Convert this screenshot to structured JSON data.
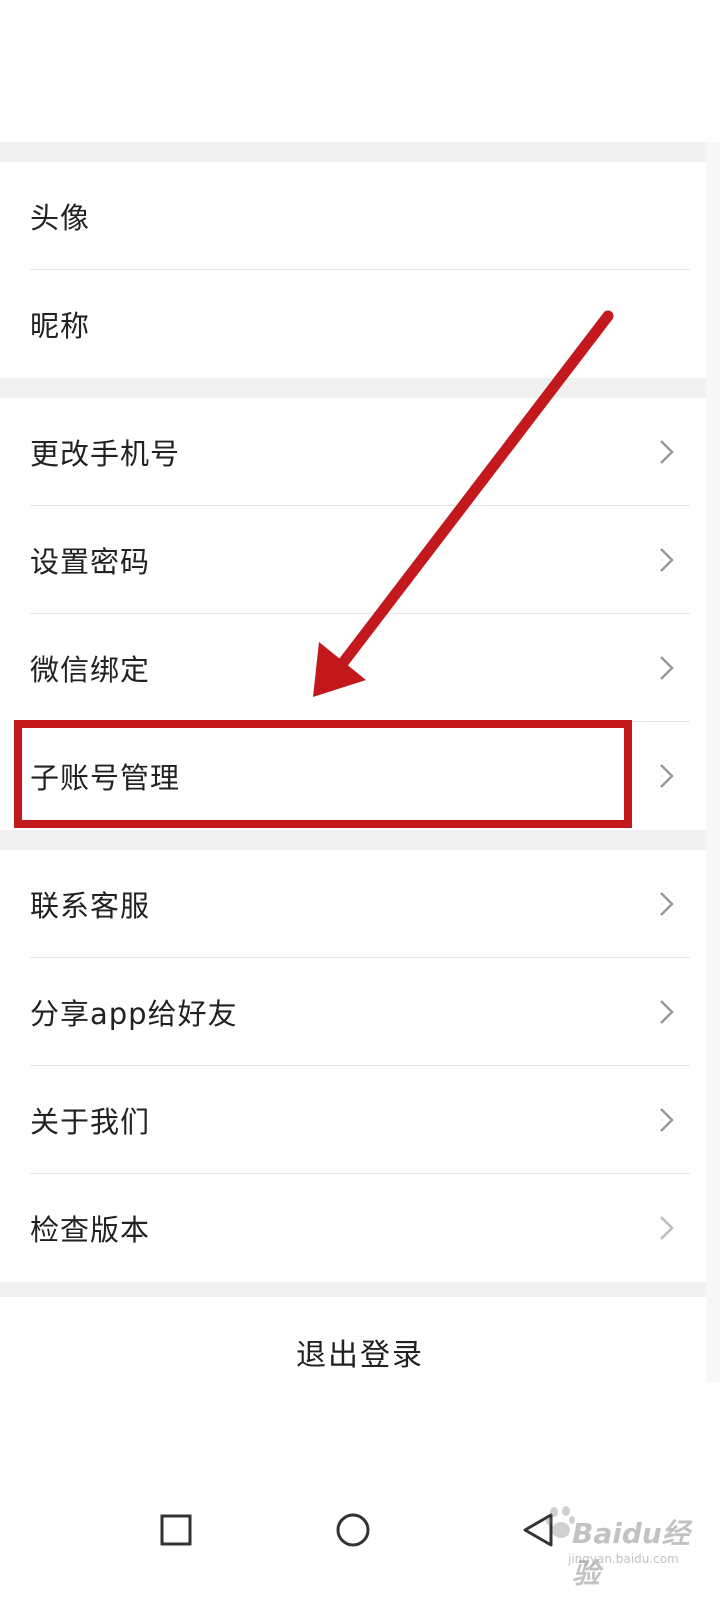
{
  "profile_group": [
    {
      "label": "头像",
      "has_chevron": false
    },
    {
      "label": "昵称",
      "has_chevron": false
    }
  ],
  "account_group": [
    {
      "label": "更改手机号",
      "has_chevron": true
    },
    {
      "label": "设置密码",
      "has_chevron": true
    },
    {
      "label": "微信绑定",
      "has_chevron": true
    },
    {
      "label": "子账号管理",
      "has_chevron": true,
      "highlighted": true
    }
  ],
  "info_group": [
    {
      "label": "联系客服",
      "has_chevron": true
    },
    {
      "label": "分享app给好友",
      "has_chevron": true
    },
    {
      "label": "关于我们",
      "has_chevron": true
    },
    {
      "label": "检查版本",
      "has_chevron": true
    }
  ],
  "logout": {
    "label": "退出登录"
  },
  "navbar": {
    "icons": [
      "recent-apps-icon",
      "home-icon",
      "back-icon"
    ]
  },
  "annotation": {
    "color": "#c4191c",
    "target": "子账号管理"
  },
  "watermark": {
    "text": "Baidu经验",
    "sub": "jingyan.baidu.com"
  }
}
